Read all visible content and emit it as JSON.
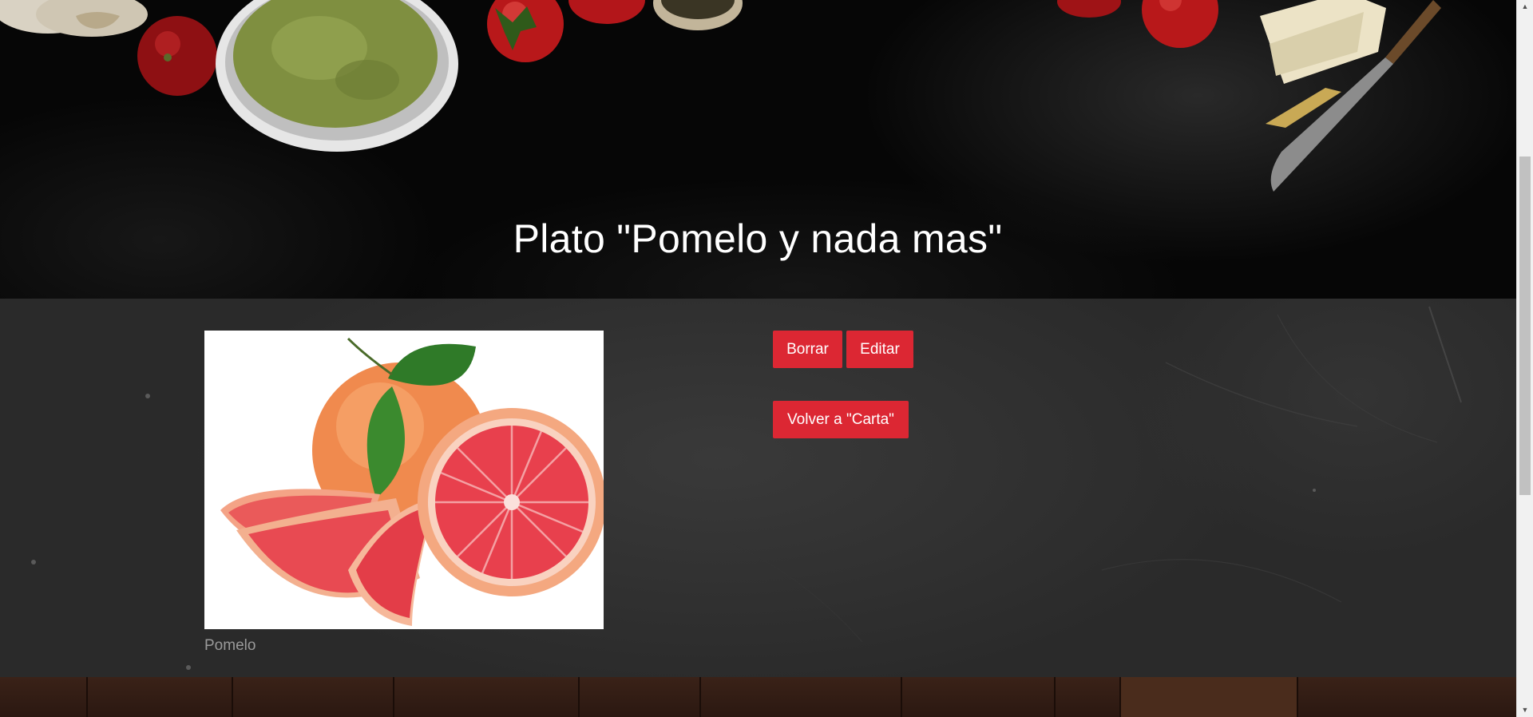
{
  "hero": {
    "title": "Plato \"Pomelo y nada mas\""
  },
  "dish": {
    "image_caption": "Pomelo"
  },
  "actions": {
    "delete_label": "Borrar",
    "edit_label": "Editar",
    "back_label": "Volver a \"Carta\""
  },
  "colors": {
    "button_bg": "#dc2733",
    "hero_bg": "#060606",
    "content_bg": "#2a2a2a",
    "caption_text": "#9a9a9a"
  },
  "icons": {
    "scroll_up": "triangle-up-icon",
    "scroll_down": "triangle-down-icon"
  }
}
